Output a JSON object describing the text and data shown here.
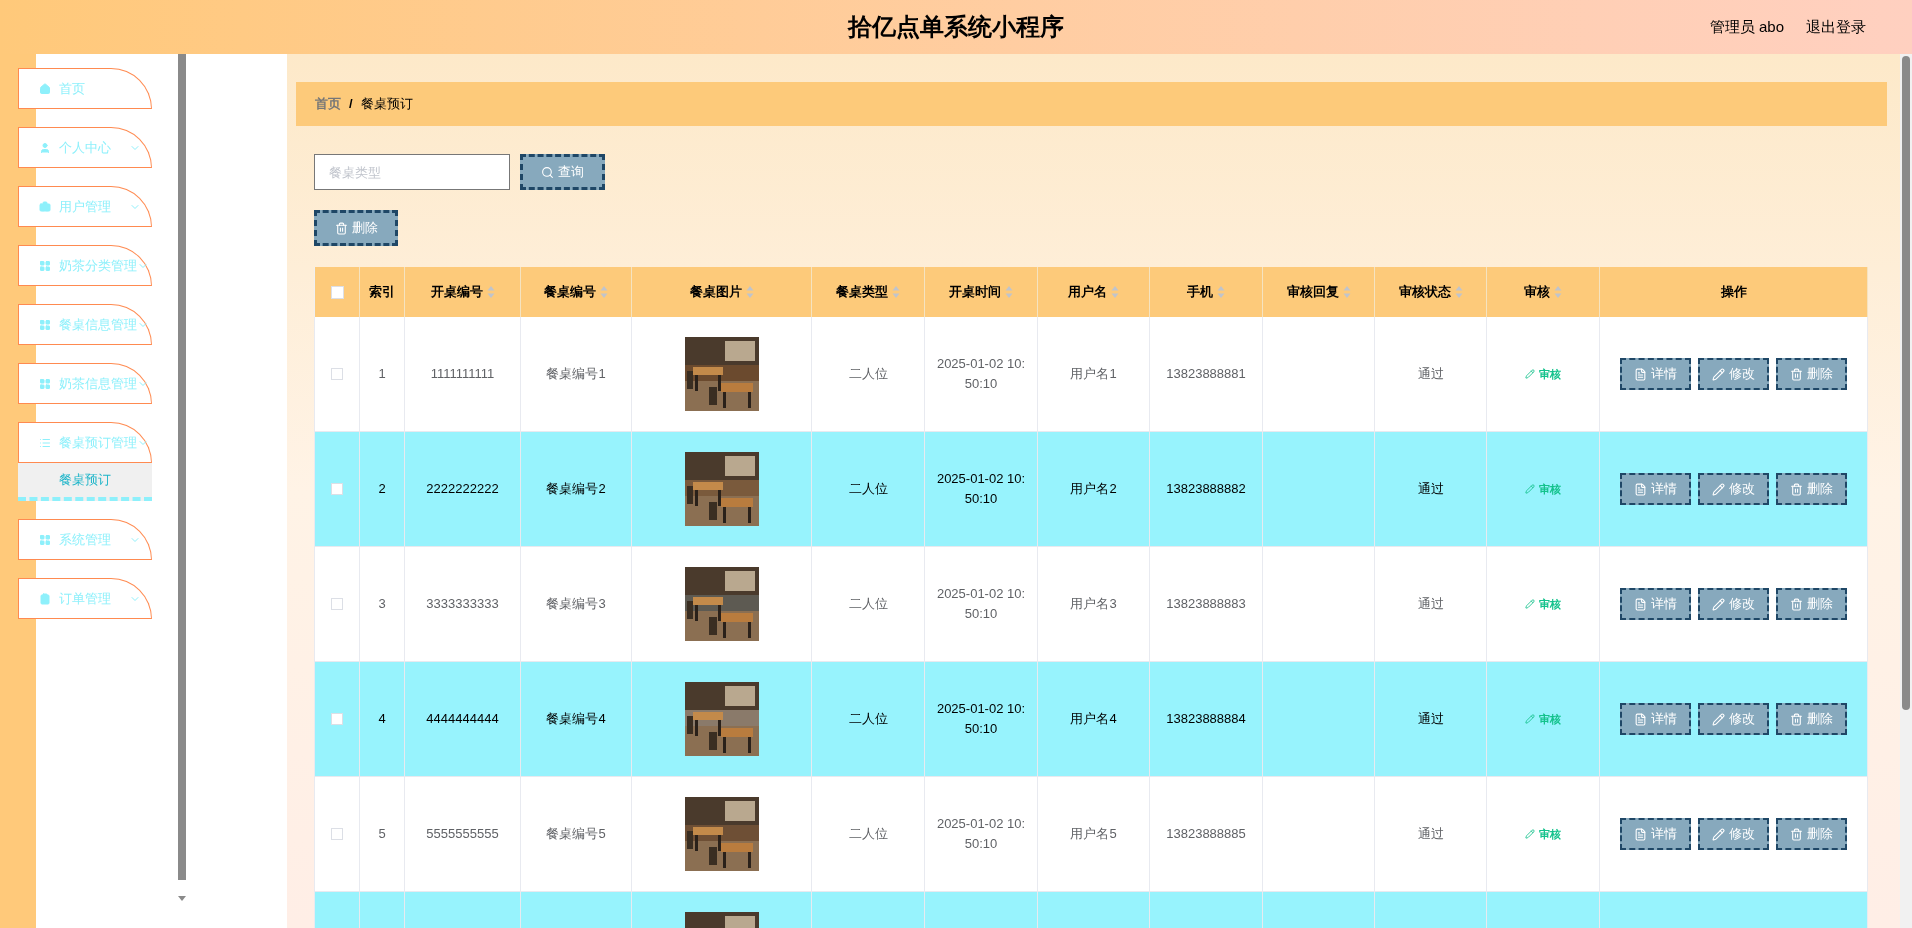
{
  "header": {
    "title": "拾亿点单系统小程序",
    "user": "管理员 abo",
    "logout": "退出登录"
  },
  "sidebar": {
    "items": [
      {
        "label": "首页",
        "kind": "link"
      },
      {
        "label": "个人中心",
        "kind": "group"
      },
      {
        "label": "用户管理",
        "kind": "group"
      },
      {
        "label": "奶茶分类管理",
        "kind": "group"
      },
      {
        "label": "餐桌信息管理",
        "kind": "group"
      },
      {
        "label": "奶茶信息管理",
        "kind": "group"
      },
      {
        "label": "餐桌预订管理",
        "kind": "group",
        "children": [
          {
            "label": "餐桌预订",
            "selected": true
          }
        ]
      },
      {
        "label": "系统管理",
        "kind": "group"
      },
      {
        "label": "订单管理",
        "kind": "group"
      }
    ]
  },
  "breadcrumb": [
    "首页",
    "/",
    "餐桌预订"
  ],
  "search": {
    "placeholder": "餐桌类型",
    "button": "查询"
  },
  "bulk_delete": "删除",
  "table": {
    "select_all_checked": false,
    "columns": [
      {
        "label": "索引",
        "sortable": false
      },
      {
        "label": "开桌编号",
        "sortable": true
      },
      {
        "label": "餐桌编号",
        "sortable": true
      },
      {
        "label": "餐桌图片",
        "sortable": true
      },
      {
        "label": "餐桌类型",
        "sortable": true
      },
      {
        "label": "开桌时间",
        "sortable": true
      },
      {
        "label": "用户名",
        "sortable": true
      },
      {
        "label": "手机",
        "sortable": true
      },
      {
        "label": "审核回复",
        "sortable": true
      },
      {
        "label": "审核状态",
        "sortable": true
      },
      {
        "label": "审核",
        "sortable": true
      },
      {
        "label": "操作",
        "sortable": false
      }
    ],
    "rows": [
      {
        "checked": false,
        "highlighted": false,
        "index": "1",
        "open_no": "1111111111",
        "table_no": "餐桌编号1",
        "type": "二人位",
        "time": "2025-01-02 10:50:10",
        "user": "用户名1",
        "phone": "13823888881",
        "status": "通过",
        "audit": "审核",
        "actions": [
          "详情",
          "修改",
          "删除"
        ]
      },
      {
        "checked": false,
        "highlighted": true,
        "index": "2",
        "open_no": "2222222222",
        "table_no": "餐桌编号2",
        "type": "二人位",
        "time": "2025-01-02 10:50:10",
        "user": "用户名2",
        "phone": "13823888882",
        "status": "通过",
        "audit": "审核",
        "actions": [
          "详情",
          "修改",
          "删除"
        ]
      },
      {
        "checked": false,
        "highlighted": false,
        "index": "3",
        "open_no": "3333333333",
        "table_no": "餐桌编号3",
        "type": "二人位",
        "time": "2025-01-02 10:50:10",
        "user": "用户名3",
        "phone": "13823888883",
        "status": "通过",
        "audit": "审核",
        "actions": [
          "详情",
          "修改",
          "删除"
        ]
      },
      {
        "checked": false,
        "highlighted": true,
        "index": "4",
        "open_no": "4444444444",
        "table_no": "餐桌编号4",
        "type": "二人位",
        "time": "2025-01-02 10:50:10",
        "user": "用户名4",
        "phone": "13823888884",
        "status": "通过",
        "audit": "审核",
        "actions": [
          "详情",
          "修改",
          "删除"
        ]
      },
      {
        "checked": false,
        "highlighted": false,
        "index": "5",
        "open_no": "5555555555",
        "table_no": "餐桌编号5",
        "type": "二人位",
        "time": "2025-01-02 10:50:10",
        "user": "用户名5",
        "phone": "13823888885",
        "status": "通过",
        "audit": "审核",
        "actions": [
          "详情",
          "修改",
          "删除"
        ]
      },
      {
        "highlighted": true
      }
    ]
  }
}
